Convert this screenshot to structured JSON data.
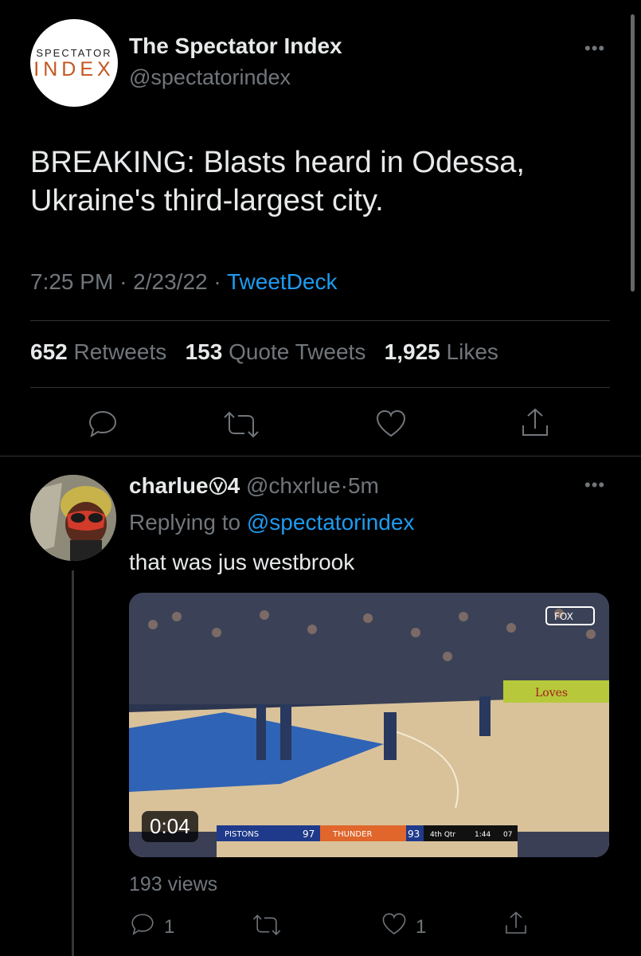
{
  "tweet": {
    "logo_top": "SPECTATOR",
    "logo_bottom": "INDEX",
    "author_name": "The Spectator Index",
    "author_handle": "@spectatorindex",
    "more_icon": "•••",
    "text": "BREAKING: Blasts heard in Odessa, Ukraine's third-largest city.",
    "time": "7:25 PM",
    "date": "2/23/22",
    "source": "TweetDeck",
    "separator": "·",
    "retweets_count": "652",
    "retweets_label": "Retweets",
    "quotes_count": "153",
    "quotes_label": "Quote Tweets",
    "likes_count": "1,925",
    "likes_label": "Likes"
  },
  "reply": {
    "author_name": "charlue",
    "name_suffix": "4",
    "badge_icon": "circled-v",
    "author_handle": "@chxrlue",
    "time_ago": "5m",
    "replying_prefix": "Replying to",
    "replying_handle": "@spectatorindex",
    "text": "that was jus westbrook",
    "video": {
      "duration": "0:04",
      "scorebug": {
        "away_team": "PISTONS",
        "away_score": "97",
        "home_team": "THUNDER",
        "home_score": "93",
        "quarter": "4th Qtr",
        "clock": "1:44",
        "shot_clock": "07"
      },
      "network": "FOX",
      "ad_text": "Loves"
    },
    "views": "193 views",
    "reply_count": "1",
    "like_count": "1"
  },
  "colors": {
    "background": "#000000",
    "text_primary": "#e7e9ea",
    "text_secondary": "#71767b",
    "link": "#1d9bf0",
    "divider": "#2f3336"
  }
}
